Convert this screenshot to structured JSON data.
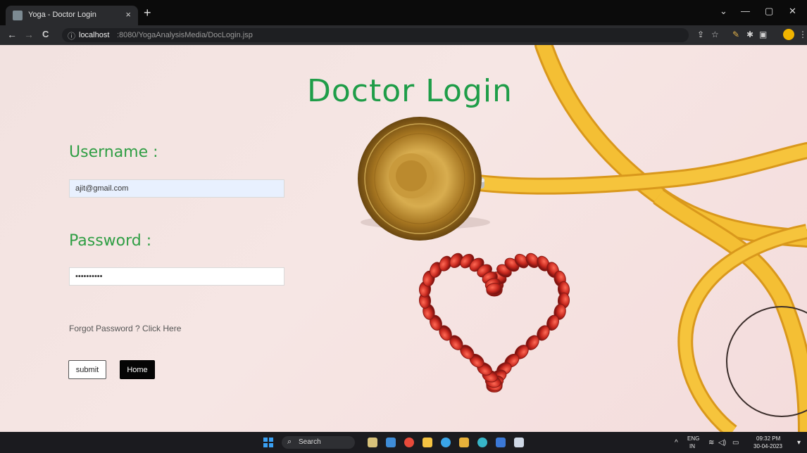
{
  "browser": {
    "tab_title": "Yoga - Doctor Login",
    "tab_close": "×",
    "new_tab": "+",
    "window": {
      "minimize": "—",
      "maximize": "▢",
      "close": "✕",
      "tab_search": "⌄"
    },
    "url_host": "localhost",
    "url_path": ":8080/YogaAnalysisMedia/DocLogin.jsp",
    "nav": {
      "back": "←",
      "forward": "→",
      "reload": "C"
    },
    "info_icon": "ⓘ"
  },
  "page": {
    "heading": "Doctor Login",
    "username_label": "Username :",
    "username_value": "ajit@gmail.com",
    "password_label": "Password :",
    "password_value": "ajit123456",
    "forgot_link": "Forgot Password ? Click Here",
    "submit_label": "submit",
    "home_label": "Home"
  },
  "taskbar": {
    "search_label": "Search",
    "language": "ENG",
    "region": "IN",
    "time": "09:32 PM",
    "date": "30-04-2023"
  },
  "colors": {
    "accent_green": "#1f9d48",
    "page_background": "#f4e4e2",
    "stethoscope_tube": "#f1b82c",
    "heart_beads": "#c8291f"
  }
}
